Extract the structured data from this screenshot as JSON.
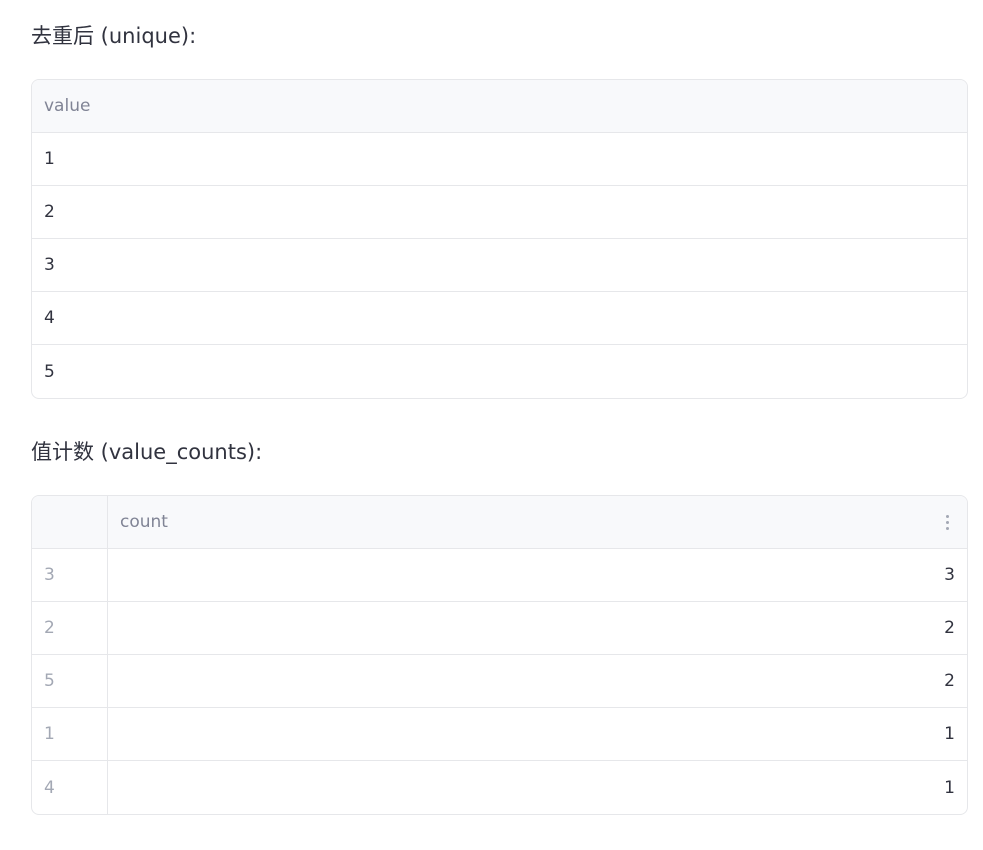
{
  "unique_section": {
    "title": "去重后 (unique):",
    "table": {
      "header": "value",
      "rows": [
        "1",
        "2",
        "3",
        "4",
        "5"
      ]
    }
  },
  "counts_section": {
    "title": "值计数 (value_counts):",
    "table": {
      "index_header": "",
      "count_header": "count",
      "menu_icon": "more-vertical-icon",
      "rows": [
        {
          "index": "3",
          "count": "3"
        },
        {
          "index": "2",
          "count": "2"
        },
        {
          "index": "5",
          "count": "2"
        },
        {
          "index": "1",
          "count": "1"
        },
        {
          "index": "4",
          "count": "1"
        }
      ]
    }
  }
}
